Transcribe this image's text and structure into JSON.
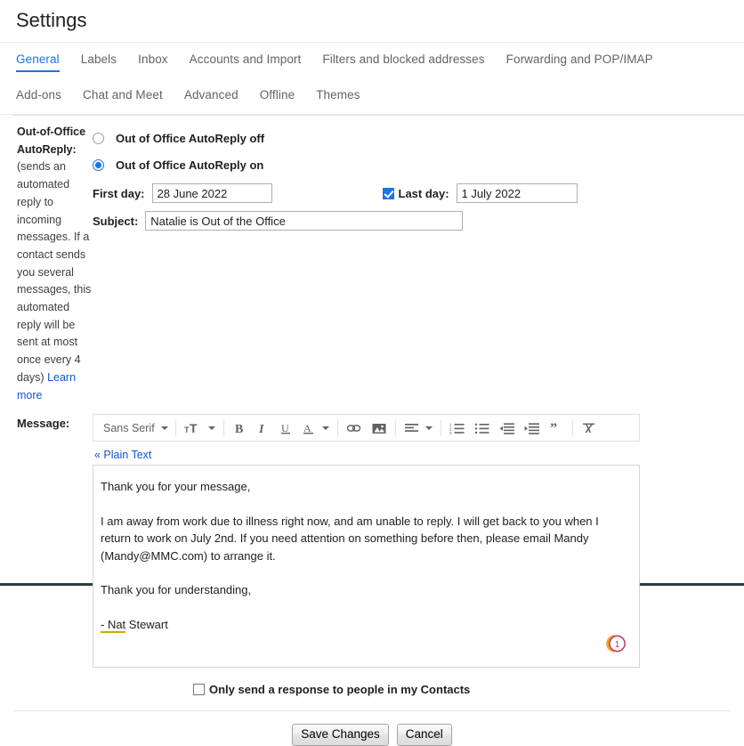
{
  "header": {
    "title": "Settings"
  },
  "tabs": {
    "row1": [
      {
        "label": "General",
        "active": true
      },
      {
        "label": "Labels",
        "active": false
      },
      {
        "label": "Inbox",
        "active": false
      },
      {
        "label": "Accounts and Import",
        "active": false
      },
      {
        "label": "Filters and blocked addresses",
        "active": false
      },
      {
        "label": "Forwarding and POP/IMAP",
        "active": false
      }
    ],
    "row2": [
      {
        "label": "Add-ons",
        "active": false
      },
      {
        "label": "Chat and Meet",
        "active": false
      },
      {
        "label": "Advanced",
        "active": false
      },
      {
        "label": "Offline",
        "active": false
      },
      {
        "label": "Themes",
        "active": false
      }
    ]
  },
  "section": {
    "title": "Out-of-Office AutoReply:",
    "description": "(sends an automated reply to incoming messages. If a contact sends you several messages, this automated reply will be sent at most once every 4 days)",
    "learn_more": "Learn more"
  },
  "autoreply": {
    "off_label": "Out of Office AutoReply off",
    "on_label": "Out of Office AutoReply on",
    "selected": "on"
  },
  "first_day": {
    "label": "First day:",
    "value": "28 June 2022",
    "placeholder": ""
  },
  "last_day": {
    "label": "Last day:",
    "value": "1 July 2022",
    "checked": true,
    "placeholder": ""
  },
  "subject": {
    "label": "Subject:",
    "value": "Natalie is Out of the Office",
    "placeholder": ""
  },
  "message": {
    "label": "Message:",
    "plain_text_link": "« Plain Text",
    "paragraphs": [
      "Thank you for your message,",
      "I am away from work due to illness right now, and am unable to reply. I will get back to you when I return to work on July 2nd. If you need attention on something before then, please email Mandy (Mandy@MMC.com) to arrange it.",
      "Thank you for understanding,"
    ],
    "signature_misspelled": "- Nat",
    "signature_rest": " Stewart",
    "grammarly_count": "1"
  },
  "toolbar": {
    "font_name": "Sans Serif",
    "items": [
      {
        "name": "font-family-dropdown",
        "label": "Sans Serif"
      },
      {
        "name": "font-size-icon",
        "label": "Font size"
      },
      {
        "name": "bold-icon",
        "label": "Bold"
      },
      {
        "name": "italic-icon",
        "label": "Italic"
      },
      {
        "name": "underline-icon",
        "label": "Underline"
      },
      {
        "name": "text-color-icon",
        "label": "Text color"
      },
      {
        "name": "link-icon",
        "label": "Insert link"
      },
      {
        "name": "image-icon",
        "label": "Insert image"
      },
      {
        "name": "align-icon",
        "label": "Align"
      },
      {
        "name": "numbered-list-icon",
        "label": "Numbered list"
      },
      {
        "name": "bulleted-list-icon",
        "label": "Bulleted list"
      },
      {
        "name": "indent-less-icon",
        "label": "Indent less"
      },
      {
        "name": "indent-more-icon",
        "label": "Indent more"
      },
      {
        "name": "quote-icon",
        "label": "Quote"
      },
      {
        "name": "remove-formatting-icon",
        "label": "Remove formatting"
      }
    ]
  },
  "contacts_only": {
    "label": "Only send a response to people in my Contacts",
    "checked": false
  },
  "buttons": {
    "save": "Save Changes",
    "cancel": "Cancel"
  },
  "colors": {
    "accent": "#1a73e8",
    "link": "#1155cc",
    "text": "#202124",
    "muted": "#5f6368",
    "spellcheck": "#d6a700",
    "grammarly": "#c7305f"
  }
}
